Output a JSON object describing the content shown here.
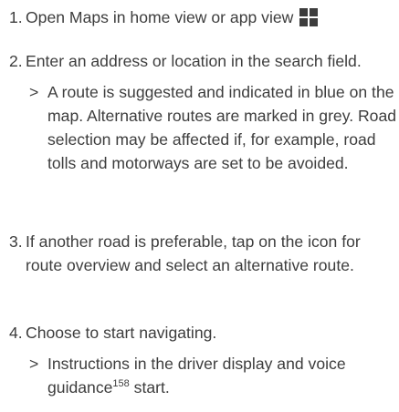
{
  "steps": [
    {
      "number": "1.",
      "text": "Open Maps in home view or app view"
    },
    {
      "number": "2.",
      "text": "Enter an address or location in the search field.",
      "result_marker": ">",
      "result": "A route is suggested and indicated in blue on the map. Alternative routes are marked in grey. Road selection may be affected if, for example, road tolls and motorways are set to be avoided."
    },
    {
      "number": "3.",
      "text": "If another road is preferable, tap on the icon for route overview and select an alternative route."
    },
    {
      "number": "4.",
      "text": "Choose to start navigating.",
      "result_marker": ">",
      "result_before": "Instructions in the driver display and voice guidance",
      "result_footnote": "158",
      "result_after": " start."
    }
  ],
  "icons": {
    "app_view": "app-grid-icon"
  },
  "colors": {
    "text": "#3d3d3d",
    "icon": "#3d3d3d"
  }
}
